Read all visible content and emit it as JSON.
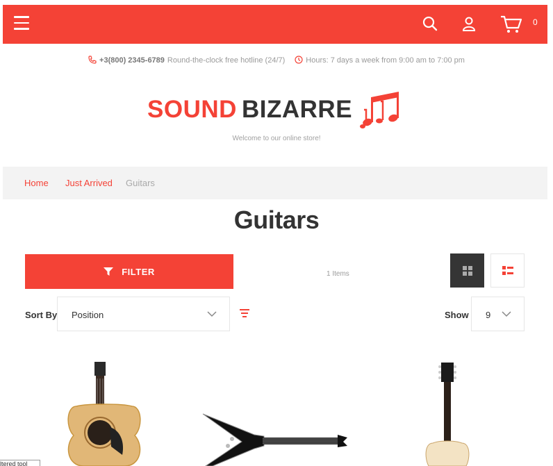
{
  "header": {
    "cart_count": "0",
    "icons": [
      "menu-icon",
      "search-icon",
      "user-icon",
      "cart-icon"
    ]
  },
  "info": {
    "phone": "+3(800) 2345-6789",
    "hotline_text": "Round-the-clock free hotline (24/7)",
    "hours_text": "Hours: 7 days a week from 9:00 am to 7:00 pm"
  },
  "logo": {
    "part1": "SOUND",
    "part2": "BIZARRE",
    "tagline": "Welcome to our online store!"
  },
  "breadcrumb": {
    "home": "Home",
    "just_arrived": "Just Arrived",
    "current": "Guitars"
  },
  "page": {
    "title": "Guitars"
  },
  "toolbar": {
    "filter_label": "FILTER",
    "items_count": "1 Items",
    "sort_by_label": "Sort By",
    "sort_value": "Position",
    "show_label": "Show",
    "show_value": "9"
  },
  "tooltip": {
    "text": "ltered tool"
  },
  "colors": {
    "accent": "#f44236",
    "dark": "#353535",
    "breadcrumb_bg": "#f3f3f3"
  }
}
